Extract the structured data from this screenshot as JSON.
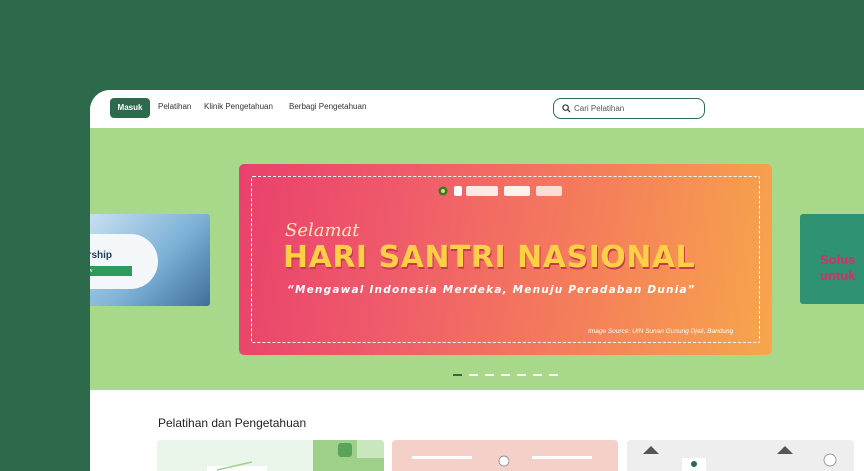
{
  "nav": {
    "login_label": "Masuk",
    "links": [
      "Pelatihan",
      "Klinik Pengetahuan",
      "Berbagi Pengetahuan"
    ],
    "search_placeholder": "Cari Pelatihan"
  },
  "carousel": {
    "left_card": {
      "line1": "ership",
      "line2": "ow"
    },
    "banner": {
      "logos": [
        "kemenag-logo",
        "ptkin-logo",
        "pesantren-logo",
        "pintar-logo",
        "sub-logo"
      ],
      "script_heading": "Selamat",
      "title": "HARI SANTRI NASIONAL",
      "subtitle": "“Mengawal Indonesia Merdeka, Menuju Peradaban Dunia”",
      "source": "Image Source: UIN Sunan Gunung Djati, Bandung"
    },
    "right_card": {
      "line1": "Solus",
      "line2": "untuk"
    },
    "slide_count": 7,
    "active_slide": 0
  },
  "section": {
    "title": "Pelatihan dan Pengetahuan"
  },
  "colors": {
    "brand_green": "#2d6a4b",
    "hero_bg": "#a8d98a",
    "title_yellow": "#ffcf46"
  }
}
